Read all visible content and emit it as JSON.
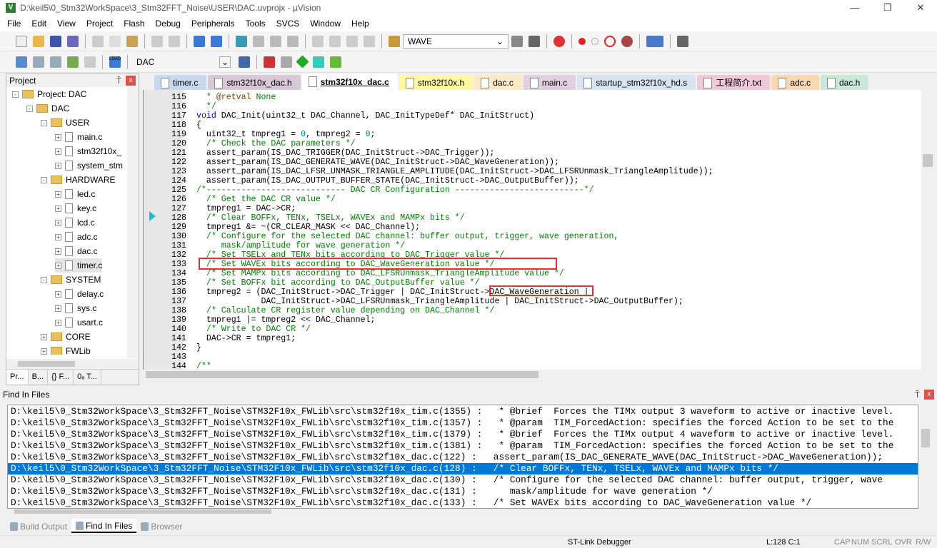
{
  "window": {
    "title": "D:\\keil5\\0_Stm32WorkSpace\\3_Stm32FFT_Noise\\USER\\DAC.uvprojx - µVision",
    "minimize": "—",
    "maximize": "❐",
    "close": "✕"
  },
  "menu": [
    "File",
    "Edit",
    "View",
    "Project",
    "Flash",
    "Debug",
    "Peripherals",
    "Tools",
    "SVCS",
    "Window",
    "Help"
  ],
  "toolbar": {
    "find_combo": "WAVE",
    "target_combo": "DAC",
    "load_label": "LOAD"
  },
  "project": {
    "title": "Project",
    "pin": "⍑",
    "close": "x",
    "tree": [
      {
        "label": "Project: DAC",
        "depth": 0,
        "type": "root",
        "exp": "-"
      },
      {
        "label": "DAC",
        "depth": 1,
        "type": "folder",
        "exp": "-"
      },
      {
        "label": "USER",
        "depth": 2,
        "type": "folder",
        "exp": "-"
      },
      {
        "label": "main.c",
        "depth": 3,
        "type": "file",
        "exp": "+"
      },
      {
        "label": "stm32f10x_",
        "depth": 3,
        "type": "file",
        "exp": "+"
      },
      {
        "label": "system_stm",
        "depth": 3,
        "type": "file",
        "exp": "+"
      },
      {
        "label": "HARDWARE",
        "depth": 2,
        "type": "folder",
        "exp": "-"
      },
      {
        "label": "led.c",
        "depth": 3,
        "type": "file",
        "exp": "+"
      },
      {
        "label": "key.c",
        "depth": 3,
        "type": "file",
        "exp": "+"
      },
      {
        "label": "lcd.c",
        "depth": 3,
        "type": "file",
        "exp": "+"
      },
      {
        "label": "adc.c",
        "depth": 3,
        "type": "file",
        "exp": "+"
      },
      {
        "label": "dac.c",
        "depth": 3,
        "type": "file",
        "exp": "+"
      },
      {
        "label": "timer.c",
        "depth": 3,
        "type": "file",
        "exp": "+"
      },
      {
        "label": "SYSTEM",
        "depth": 2,
        "type": "folder",
        "exp": "-"
      },
      {
        "label": "delay.c",
        "depth": 3,
        "type": "file",
        "exp": "+"
      },
      {
        "label": "sys.c",
        "depth": 3,
        "type": "file",
        "exp": "+"
      },
      {
        "label": "usart.c",
        "depth": 3,
        "type": "file",
        "exp": "+"
      },
      {
        "label": "CORE",
        "depth": 2,
        "type": "folder",
        "exp": "+"
      },
      {
        "label": "FWLib",
        "depth": 2,
        "type": "folder",
        "exp": "+"
      }
    ],
    "tabs": [
      "Pr...",
      "B...",
      "{} F...",
      "0ₐ T..."
    ]
  },
  "editor": {
    "tabs": [
      {
        "label": "timer.c",
        "color": "#c8d8f0",
        "active": false
      },
      {
        "label": "stm32f10x_dac.h",
        "color": "#d8c8d8",
        "active": false
      },
      {
        "label": "stm32f10x_dac.c",
        "color": "#ffffff",
        "active": true
      },
      {
        "label": "stm32f10x.h",
        "color": "#fff8a0",
        "active": false
      },
      {
        "label": "dac.c",
        "color": "#fde8c8",
        "active": false
      },
      {
        "label": "main.c",
        "color": "#e0d0e0",
        "active": false
      },
      {
        "label": "startup_stm32f10x_hd.s",
        "color": "#d8e4f0",
        "active": false
      },
      {
        "label": "工程简介.txt",
        "color": "#f0c8d8",
        "active": false
      },
      {
        "label": "adc.c",
        "color": "#fcd8b0",
        "active": false
      },
      {
        "label": "dac.h",
        "color": "#c8e8d8",
        "active": false
      }
    ],
    "lines": [
      {
        "n": "115",
        "s": [
          [
            "  * ",
            "cm"
          ],
          [
            "@retval",
            "kw2"
          ],
          [
            " None",
            "cm"
          ]
        ]
      },
      {
        "n": "116",
        "s": [
          [
            "  */",
            "cm"
          ]
        ]
      },
      {
        "n": "117",
        "s": [
          [
            "void",
            "k"
          ],
          [
            " DAC_Init(uint32_t DAC_Channel, DAC_InitTypeDef* DAC_InitStruct)",
            ""
          ]
        ]
      },
      {
        "n": "118",
        "s": [
          [
            "{",
            ""
          ]
        ]
      },
      {
        "n": "119",
        "s": [
          [
            "  uint32_t tmpreg1 = ",
            ""
          ],
          [
            "0",
            "num"
          ],
          [
            ", tmpreg2 = ",
            ""
          ],
          [
            "0",
            "num"
          ],
          [
            ";",
            ""
          ]
        ]
      },
      {
        "n": "120",
        "s": [
          [
            "  /* Check the DAC parameters */",
            "cm"
          ]
        ]
      },
      {
        "n": "121",
        "s": [
          [
            "  assert_param(IS_DAC_TRIGGER(DAC_InitStruct->DAC_Trigger));",
            ""
          ]
        ]
      },
      {
        "n": "122",
        "s": [
          [
            "  assert_param(IS_DAC_GENERATE_WAVE(DAC_InitStruct->DAC_WaveGeneration));",
            ""
          ]
        ]
      },
      {
        "n": "123",
        "s": [
          [
            "  assert_param(IS_DAC_LFSR_UNMASK_TRIANGLE_AMPLITUDE(DAC_InitStruct->DAC_LFSRUnmask_TriangleAmplitude));",
            ""
          ]
        ]
      },
      {
        "n": "124",
        "s": [
          [
            "  assert_param(IS_DAC_OUTPUT_BUFFER_STATE(DAC_InitStruct->DAC_OutputBuffer));",
            ""
          ]
        ]
      },
      {
        "n": "125",
        "s": [
          [
            "/*---------------------------- DAC CR Configuration --------------------------*/",
            "cm"
          ]
        ]
      },
      {
        "n": "126",
        "s": [
          [
            "  /* Get the DAC CR value */",
            "cm"
          ]
        ]
      },
      {
        "n": "127",
        "s": [
          [
            "  tmpreg1 = DAC->CR;",
            ""
          ]
        ]
      },
      {
        "n": "128",
        "s": [
          [
            "  /* Clear BOFFx, TENx, TSELx, WAVEx and MAMPx bits */",
            "cm"
          ]
        ]
      },
      {
        "n": "129",
        "s": [
          [
            "  tmpreg1 &= ~(CR_CLEAR_MASK << DAC_Channel);",
            ""
          ]
        ]
      },
      {
        "n": "130",
        "s": [
          [
            "  /* Configure for the selected DAC channel: buffer output, trigger, wave generation,",
            "cm"
          ]
        ]
      },
      {
        "n": "131",
        "s": [
          [
            "     mask/amplitude for wave generation */",
            "cm"
          ]
        ]
      },
      {
        "n": "132",
        "s": [
          [
            "  /* Set TSELx and TENx bits according to DAC_Trigger value */",
            "cm"
          ]
        ]
      },
      {
        "n": "133",
        "s": [
          [
            "  /* Set WAVEx bits according to DAC_WaveGeneration value */",
            "cm"
          ]
        ]
      },
      {
        "n": "134",
        "s": [
          [
            "  /* Set MAMPx bits according to DAC_LFSRUnmask_TriangleAmplitude value */",
            "cm"
          ]
        ]
      },
      {
        "n": "135",
        "s": [
          [
            "  /* Set BOFFx bit according to DAC_OutputBuffer value */",
            "cm"
          ]
        ]
      },
      {
        "n": "136",
        "s": [
          [
            "  tmpreg2 = (DAC_InitStruct->DAC_Trigger | DAC_InitStruct->DAC_WaveGeneration |",
            ""
          ]
        ]
      },
      {
        "n": "137",
        "s": [
          [
            "             DAC_InitStruct->DAC_LFSRUnmask_TriangleAmplitude | DAC_InitStruct->DAC_OutputBuffer);",
            ""
          ]
        ]
      },
      {
        "n": "138",
        "s": [
          [
            "  /* Calculate CR register value depending on DAC_Channel */",
            "cm"
          ]
        ]
      },
      {
        "n": "139",
        "s": [
          [
            "  tmpreg1 |= tmpreg2 << DAC_Channel;",
            ""
          ]
        ]
      },
      {
        "n": "140",
        "s": [
          [
            "  /* Write to DAC CR */",
            "cm"
          ]
        ]
      },
      {
        "n": "141",
        "s": [
          [
            "  DAC->CR = tmpreg1;",
            ""
          ]
        ]
      },
      {
        "n": "142",
        "s": [
          [
            "}",
            ""
          ]
        ]
      },
      {
        "n": "143",
        "s": [
          [
            "",
            ""
          ]
        ]
      },
      {
        "n": "144",
        "s": [
          [
            "/**",
            "cm"
          ]
        ]
      }
    ]
  },
  "find": {
    "title": "Find In Files",
    "pin": "⍑",
    "close": "x",
    "rows": [
      "D:\\keil5\\0_Stm32WorkSpace\\3_Stm32FFT_Noise\\STM32F10x_FWLib\\src\\stm32f10x_tim.c(1355) :   * @brief  Forces the TIMx output 3 waveform to active or inactive level.",
      "D:\\keil5\\0_Stm32WorkSpace\\3_Stm32FFT_Noise\\STM32F10x_FWLib\\src\\stm32f10x_tim.c(1357) :   * @param  TIM_ForcedAction: specifies the forced Action to be set to the",
      "D:\\keil5\\0_Stm32WorkSpace\\3_Stm32FFT_Noise\\STM32F10x_FWLib\\src\\stm32f10x_tim.c(1379) :   * @brief  Forces the TIMx output 4 waveform to active or inactive level.",
      "D:\\keil5\\0_Stm32WorkSpace\\3_Stm32FFT_Noise\\STM32F10x_FWLib\\src\\stm32f10x_tim.c(1381) :   * @param  TIM_ForcedAction: specifies the forced Action to be set to the",
      "D:\\keil5\\0_Stm32WorkSpace\\3_Stm32FFT_Noise\\STM32F10x_FWLib\\src\\stm32f10x_dac.c(122) :   assert_param(IS_DAC_GENERATE_WAVE(DAC_InitStruct->DAC_WaveGeneration));",
      "D:\\keil5\\0_Stm32WorkSpace\\3_Stm32FFT_Noise\\STM32F10x_FWLib\\src\\stm32f10x_dac.c(128) :   /* Clear BOFFx, TENx, TSELx, WAVEx and MAMPx bits */",
      "D:\\keil5\\0_Stm32WorkSpace\\3_Stm32FFT_Noise\\STM32F10x_FWLib\\src\\stm32f10x_dac.c(130) :   /* Configure for the selected DAC channel: buffer output, trigger, wave",
      "D:\\keil5\\0_Stm32WorkSpace\\3_Stm32FFT_Noise\\STM32F10x_FWLib\\src\\stm32f10x_dac.c(131) :      mask/amplitude for wave generation */",
      "D:\\keil5\\0_Stm32WorkSpace\\3_Stm32FFT_Noise\\STM32F10x_FWLib\\src\\stm32f10x_dac.c(133) :   /* Set WAVEx bits according to DAC_WaveGeneration value */"
    ],
    "selected_row": 5
  },
  "bottom_tabs": [
    {
      "label": "Build Output",
      "active": false
    },
    {
      "label": "Find In Files",
      "active": true
    },
    {
      "label": "Browser",
      "active": false
    }
  ],
  "status": {
    "debugger": "ST-Link Debugger",
    "position": "L:128 C:1",
    "cap": "CAP",
    "num": "NUM",
    "scrl": "SCRL",
    "ovr": "OVR",
    "rw": "R/W"
  },
  "colors": {
    "selection": "#0078d7",
    "highlight_box": "#e8312f",
    "comment": "#008000",
    "keyword": "#0000ff"
  }
}
